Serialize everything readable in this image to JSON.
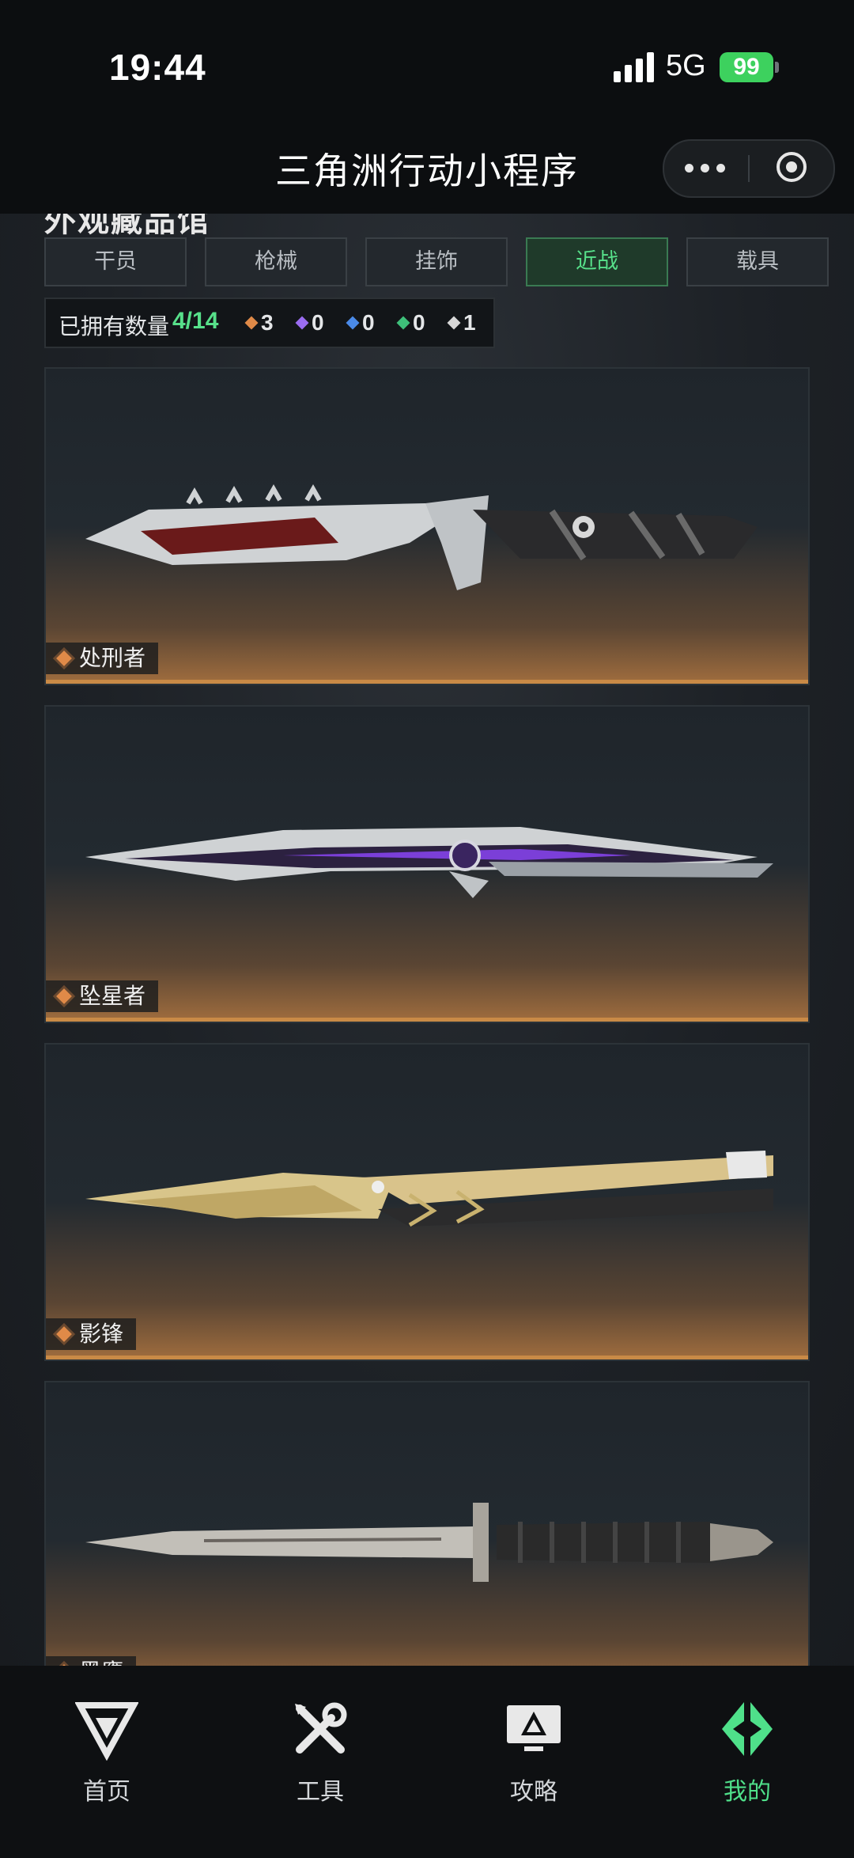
{
  "status_bar": {
    "time": "19:44",
    "network": "5G",
    "battery": "99"
  },
  "header": {
    "title": "三角洲行动小程序"
  },
  "section_title": "外观藏品馆",
  "tabs": [
    {
      "label": "干员",
      "active": false
    },
    {
      "label": "枪械",
      "active": false
    },
    {
      "label": "挂饰",
      "active": false
    },
    {
      "label": "近战",
      "active": true
    },
    {
      "label": "载具",
      "active": false
    }
  ],
  "owned": {
    "label": "已拥有数量",
    "count": "4/14",
    "rarities": [
      {
        "color": "#e08a48",
        "value": "3"
      },
      {
        "color": "#9a6cf0",
        "value": "0"
      },
      {
        "color": "#4a8ae8",
        "value": "0"
      },
      {
        "color": "#3ec07a",
        "value": "0"
      },
      {
        "color": "#d8d8d8",
        "value": "1"
      }
    ]
  },
  "items": [
    {
      "name": "处刑者",
      "icon": "diamond-icon"
    },
    {
      "name": "坠星者",
      "icon": "diamond-icon"
    },
    {
      "name": "影锋",
      "icon": "diamond-icon"
    },
    {
      "name": "黑鹰",
      "icon": "diamond-icon"
    }
  ],
  "bottom_nav": [
    {
      "label": "首页",
      "icon": "home-logo-icon",
      "active": false
    },
    {
      "label": "工具",
      "icon": "tools-icon",
      "active": false
    },
    {
      "label": "攻略",
      "icon": "guide-icon",
      "active": false
    },
    {
      "label": "我的",
      "icon": "profile-logo-icon",
      "active": true
    }
  ],
  "colors": {
    "accent": "#57e08a",
    "orange_rarity": "#e08a48",
    "background": "#1b1f23"
  }
}
